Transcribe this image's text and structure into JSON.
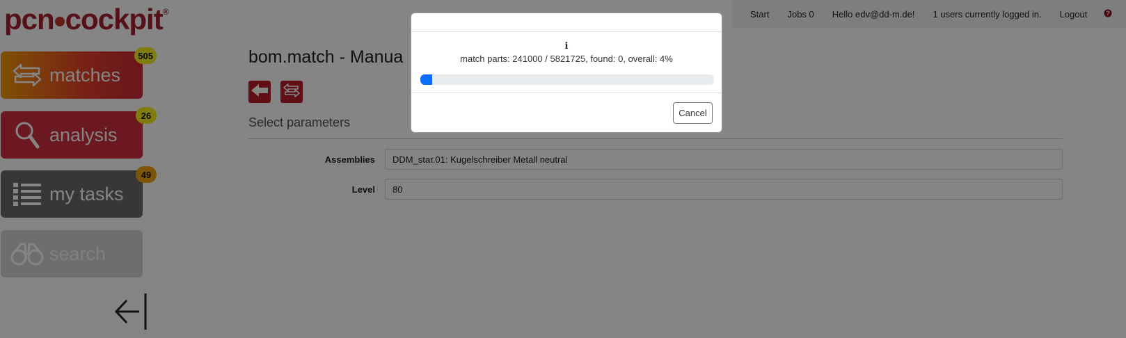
{
  "brand": {
    "logo_text_1": "pcn",
    "logo_text_2": "cockpit",
    "logo_reg": "®"
  },
  "topnav": {
    "start": "Start",
    "jobs": "Jobs 0",
    "hello": "Hello edv@dd-m.de!",
    "users": "1 users currently logged in.",
    "logout": "Logout",
    "help_icon": "question-circle-icon"
  },
  "sidebar": {
    "items": [
      {
        "label": "matches",
        "badge": "505",
        "icon": "swap-arrows-icon"
      },
      {
        "label": "analysis",
        "badge": "26",
        "icon": "magnifier-icon"
      },
      {
        "label": "my tasks",
        "badge": "49",
        "icon": "list-icon"
      },
      {
        "label": "search",
        "icon": "binoculars-icon"
      }
    ],
    "collapse_icon": "arrow-left-bar-icon"
  },
  "main": {
    "title": "bom.match - Manua",
    "section_title": "Select parameters",
    "fields": [
      {
        "label": "Assemblies",
        "value": "DDM_star.01: Kugelschreiber Metall neutral"
      },
      {
        "label": "Level",
        "value": "80"
      }
    ]
  },
  "modal": {
    "info_glyph": "ℹ",
    "message": "match parts: 241000 / 5821725, found: 0, overall: 4%",
    "progress": 0.04,
    "cancel_label": "Cancel"
  },
  "colors": {
    "brand_red": "#b81e2d",
    "progress_blue": "#0d6efd",
    "badge_yellow": "#f5ed1a",
    "badge_orange": "#f0a40f"
  }
}
